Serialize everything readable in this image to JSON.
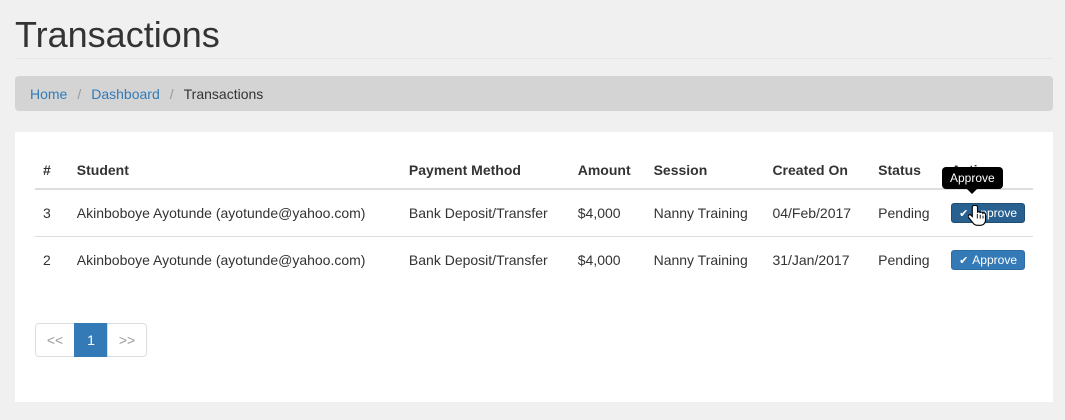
{
  "page": {
    "title": "Transactions"
  },
  "breadcrumb": {
    "home": "Home",
    "dashboard": "Dashboard",
    "current": "Transactions",
    "separator": "/"
  },
  "table": {
    "headers": [
      "#",
      "Student",
      "Payment Method",
      "Amount",
      "Session",
      "Created On",
      "Status",
      "Action"
    ],
    "rows": [
      {
        "id": "3",
        "student": "Akinboboye Ayotunde (ayotunde@yahoo.com)",
        "method": "Bank Deposit/Transfer",
        "amount": "$4,000",
        "session": "Nanny Training",
        "created": "04/Feb/2017",
        "status": "Pending",
        "action": "Approve"
      },
      {
        "id": "2",
        "student": "Akinboboye Ayotunde (ayotunde@yahoo.com)",
        "method": "Bank Deposit/Transfer",
        "amount": "$4,000",
        "session": "Nanny Training",
        "created": "31/Jan/2017",
        "status": "Pending",
        "action": "Approve"
      }
    ]
  },
  "tooltip": {
    "text": "Approve"
  },
  "pagination": {
    "prev": "<<",
    "current": "1",
    "next": ">>"
  },
  "colors": {
    "accent": "#337ab7",
    "breadcrumb_bg": "#d4d4d4",
    "page_bg": "#f0f0f0"
  }
}
